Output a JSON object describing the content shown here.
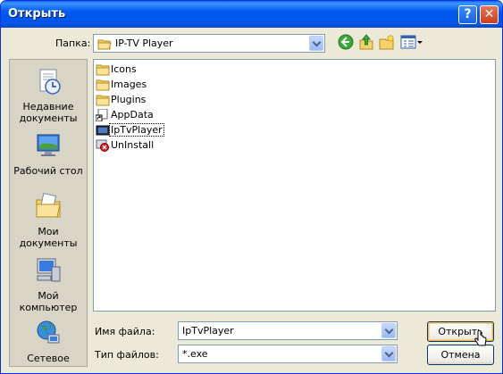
{
  "window": {
    "title": "Открыть",
    "help_glyph": "?",
    "close_glyph": "✕"
  },
  "toolbar": {
    "folder_label": "Папка:",
    "current_folder": "IP-TV Player",
    "icons": [
      "back-icon",
      "up-folder-icon",
      "new-folder-icon",
      "view-menu-icon"
    ]
  },
  "places": [
    {
      "label": "Недавние документы",
      "icon": "recent-documents-icon"
    },
    {
      "label": "Рабочий стол",
      "icon": "desktop-icon"
    },
    {
      "label": "Мои документы",
      "icon": "my-documents-icon"
    },
    {
      "label": "Мой компьютер",
      "icon": "my-computer-icon"
    },
    {
      "label": "Сетевое",
      "icon": "network-icon"
    }
  ],
  "files": [
    {
      "name": "Icons",
      "icon": "folder-icon"
    },
    {
      "name": "Images",
      "icon": "folder-icon"
    },
    {
      "name": "Plugins",
      "icon": "folder-icon"
    },
    {
      "name": "AppData",
      "icon": "shortcut-icon"
    },
    {
      "name": "IpTvPlayer",
      "icon": "application-icon",
      "selected": true
    },
    {
      "name": "UnInstall",
      "icon": "uninstall-icon"
    }
  ],
  "filename": {
    "label": "Имя файла:",
    "value": "IpTvPlayer"
  },
  "filetype": {
    "label": "Тип файлов:",
    "value": "*.exe"
  },
  "buttons": {
    "open": "Открыть",
    "cancel": "Отмена"
  },
  "colors": {
    "titlebar": "#0058EE",
    "dialog_bg": "#ECE9D8",
    "folder": "#F6D36A"
  }
}
